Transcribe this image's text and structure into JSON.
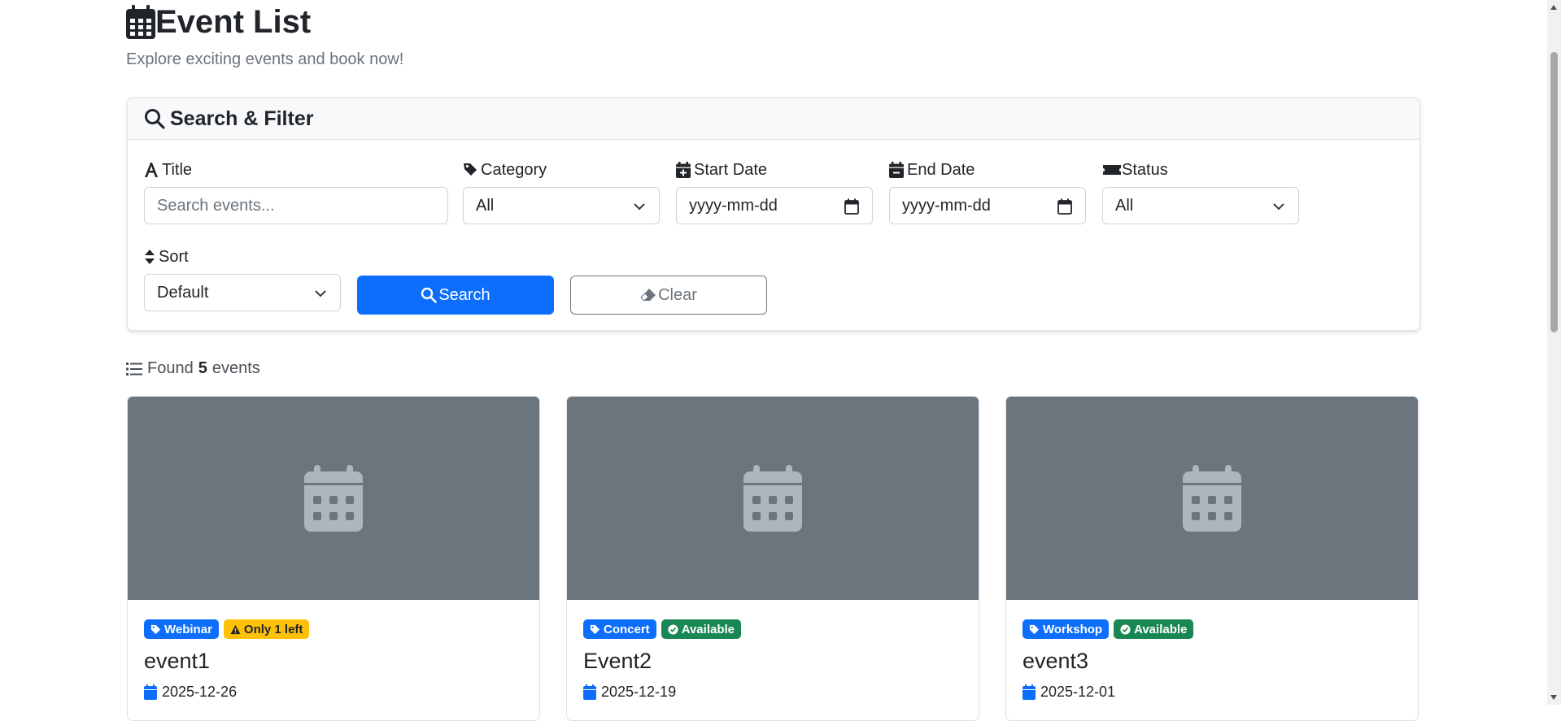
{
  "header": {
    "title": "Event List",
    "subtitle": "Explore exciting events and book now!"
  },
  "filter": {
    "heading": "Search & Filter",
    "title_label": "Title",
    "title_placeholder": "Search events...",
    "category_label": "Category",
    "category_value": "All",
    "start_label": "Start Date",
    "start_placeholder": "yyyy-mm-dd",
    "end_label": "End Date",
    "end_placeholder": "yyyy-mm-dd",
    "status_label": "Status",
    "status_value": "All",
    "sort_label": "Sort",
    "sort_value": "Default",
    "search_button": "Search",
    "clear_button": "Clear"
  },
  "results": {
    "prefix": "Found",
    "count": "5",
    "suffix": "events"
  },
  "events": [
    {
      "category": "Webinar",
      "status": "Only 1 left",
      "status_color": "#ffc107",
      "title": "event1",
      "date": "2025-12-26"
    },
    {
      "category": "Concert",
      "status": "Available",
      "status_color": "#198754",
      "title": "Event2",
      "date": "2025-12-19"
    },
    {
      "category": "Workshop",
      "status": "Available",
      "status_color": "#198754",
      "title": "event3",
      "date": "2025-12-01"
    }
  ],
  "colors": {
    "primary": "#0d6efd",
    "warning": "#ffc107",
    "success": "#198754",
    "image_bg": "#6c757d"
  }
}
